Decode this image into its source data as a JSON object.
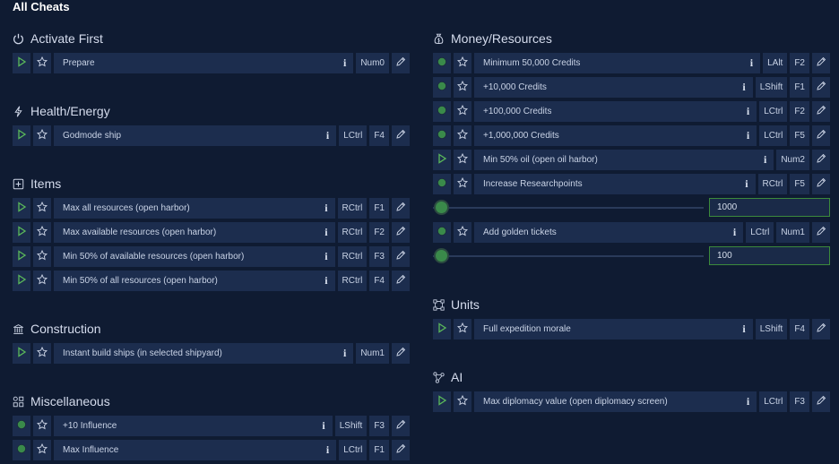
{
  "title": "All Cheats",
  "colors": {
    "background": "#0f1b32",
    "row": "#1c2d4e",
    "play": "#5ab85a",
    "toggle": "#3a8a4a",
    "slider_border": "#3c8a3c"
  },
  "left": {
    "activate_first": {
      "title": "Activate First",
      "icon": "power-icon",
      "rows": [
        {
          "type": "play",
          "label": "Prepare",
          "keys": [
            "Num0"
          ]
        }
      ]
    },
    "health_energy": {
      "title": "Health/Energy",
      "icon": "lightning-icon",
      "rows": [
        {
          "type": "play",
          "label": "Godmode ship",
          "keys": [
            "LCtrl",
            "F4"
          ]
        }
      ]
    },
    "items": {
      "title": "Items",
      "icon": "plus-box-icon",
      "rows": [
        {
          "type": "play",
          "label": "Max all resources (open harbor)",
          "keys": [
            "RCtrl",
            "F1"
          ]
        },
        {
          "type": "play",
          "label": "Max available resources (open harbor)",
          "keys": [
            "RCtrl",
            "F2"
          ]
        },
        {
          "type": "play",
          "label": "Min 50% of available resources (open harbor)",
          "keys": [
            "RCtrl",
            "F3"
          ]
        },
        {
          "type": "play",
          "label": "Min 50% of all resources (open harbor)",
          "keys": [
            "RCtrl",
            "F4"
          ]
        }
      ]
    },
    "construction": {
      "title": "Construction",
      "icon": "building-icon",
      "rows": [
        {
          "type": "play",
          "label": "Instant build ships (in selected shipyard)",
          "keys": [
            "Num1"
          ]
        }
      ]
    },
    "misc": {
      "title": "Miscellaneous",
      "icon": "grid-icon",
      "rows": [
        {
          "type": "toggle",
          "label": "+10 Influence",
          "keys": [
            "LShift",
            "F3"
          ]
        },
        {
          "type": "toggle",
          "label": "Max Influence",
          "keys": [
            "LCtrl",
            "F1"
          ]
        }
      ]
    }
  },
  "right": {
    "money": {
      "title": "Money/Resources",
      "icon": "money-bag-icon",
      "rows": [
        {
          "type": "toggle",
          "label": "Minimum 50,000 Credits",
          "keys": [
            "LAlt",
            "F2"
          ]
        },
        {
          "type": "toggle",
          "label": "+10,000 Credits",
          "keys": [
            "LShift",
            "F1"
          ]
        },
        {
          "type": "toggle",
          "label": "+100,000 Credits",
          "keys": [
            "LCtrl",
            "F2"
          ]
        },
        {
          "type": "toggle",
          "label": "+1,000,000 Credits",
          "keys": [
            "LCtrl",
            "F5"
          ]
        },
        {
          "type": "play",
          "label": "Min 50% oil (open oil harbor)",
          "keys": [
            "Num2"
          ]
        },
        {
          "type": "toggle",
          "label": "Increase Researchpoints",
          "keys": [
            "RCtrl",
            "F5"
          ]
        }
      ],
      "research_value": "1000",
      "tickets": {
        "type": "toggle",
        "label": "Add golden tickets",
        "keys": [
          "LCtrl",
          "Num1"
        ]
      },
      "tickets_value": "100"
    },
    "units": {
      "title": "Units",
      "icon": "nodes-icon",
      "rows": [
        {
          "type": "play",
          "label": "Full expedition morale",
          "keys": [
            "LShift",
            "F4"
          ]
        }
      ]
    },
    "ai": {
      "title": "AI",
      "icon": "ai-nodes-icon",
      "rows": [
        {
          "type": "play",
          "label": "Max diplomacy value (open diplomacy screen)",
          "keys": [
            "LCtrl",
            "F3"
          ]
        }
      ]
    }
  }
}
